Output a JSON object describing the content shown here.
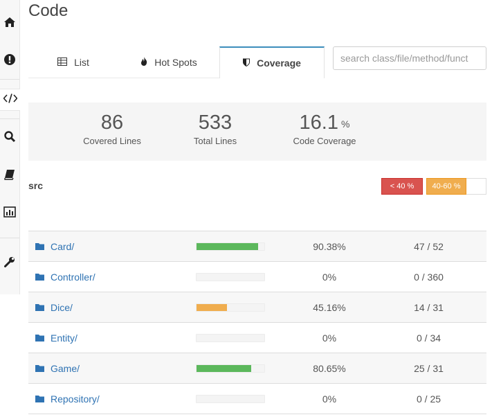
{
  "page": {
    "title": "Code"
  },
  "sidebar": {
    "items": [
      {
        "icon": "home-icon"
      },
      {
        "icon": "alert-icon"
      },
      {
        "icon": "code-icon"
      },
      {
        "icon": "search-icon"
      },
      {
        "icon": "book-icon"
      },
      {
        "icon": "chart-icon"
      },
      {
        "icon": "wrench-icon"
      }
    ]
  },
  "tabs": [
    {
      "label": "List",
      "icon": "table-icon"
    },
    {
      "label": "Hot Spots",
      "icon": "fire-icon"
    },
    {
      "label": "Coverage",
      "icon": "shield-icon",
      "active": true
    }
  ],
  "search": {
    "placeholder": "search class/file/method/funct"
  },
  "stats": {
    "covered": {
      "value": "86",
      "label": "Covered Lines"
    },
    "total": {
      "value": "533",
      "label": "Total Lines"
    },
    "coverage": {
      "value": "16.1",
      "unit": "%",
      "label": "Code Coverage"
    }
  },
  "section": {
    "title": "src"
  },
  "legend": {
    "low": "< 40 %",
    "mid": "40-60 %"
  },
  "colors": {
    "high": "#5cb85c",
    "mid": "#f0ad4e",
    "low": "#d9534f",
    "link": "#2f73b3",
    "accent": "#3c8dbc"
  },
  "rows": [
    {
      "name": "Card/",
      "percent": "90.38%",
      "lines": "47 / 52",
      "coverage": 0.9038,
      "level": "high"
    },
    {
      "name": "Controller/",
      "percent": "0%",
      "lines": "0 / 360",
      "coverage": 0,
      "level": "low"
    },
    {
      "name": "Dice/",
      "percent": "45.16%",
      "lines": "14 / 31",
      "coverage": 0.4516,
      "level": "mid"
    },
    {
      "name": "Entity/",
      "percent": "0%",
      "lines": "0 / 34",
      "coverage": 0,
      "level": "low"
    },
    {
      "name": "Game/",
      "percent": "80.65%",
      "lines": "25 / 31",
      "coverage": 0.8065,
      "level": "high"
    },
    {
      "name": "Repository/",
      "percent": "0%",
      "lines": "0 / 25",
      "coverage": 0,
      "level": "low"
    }
  ]
}
